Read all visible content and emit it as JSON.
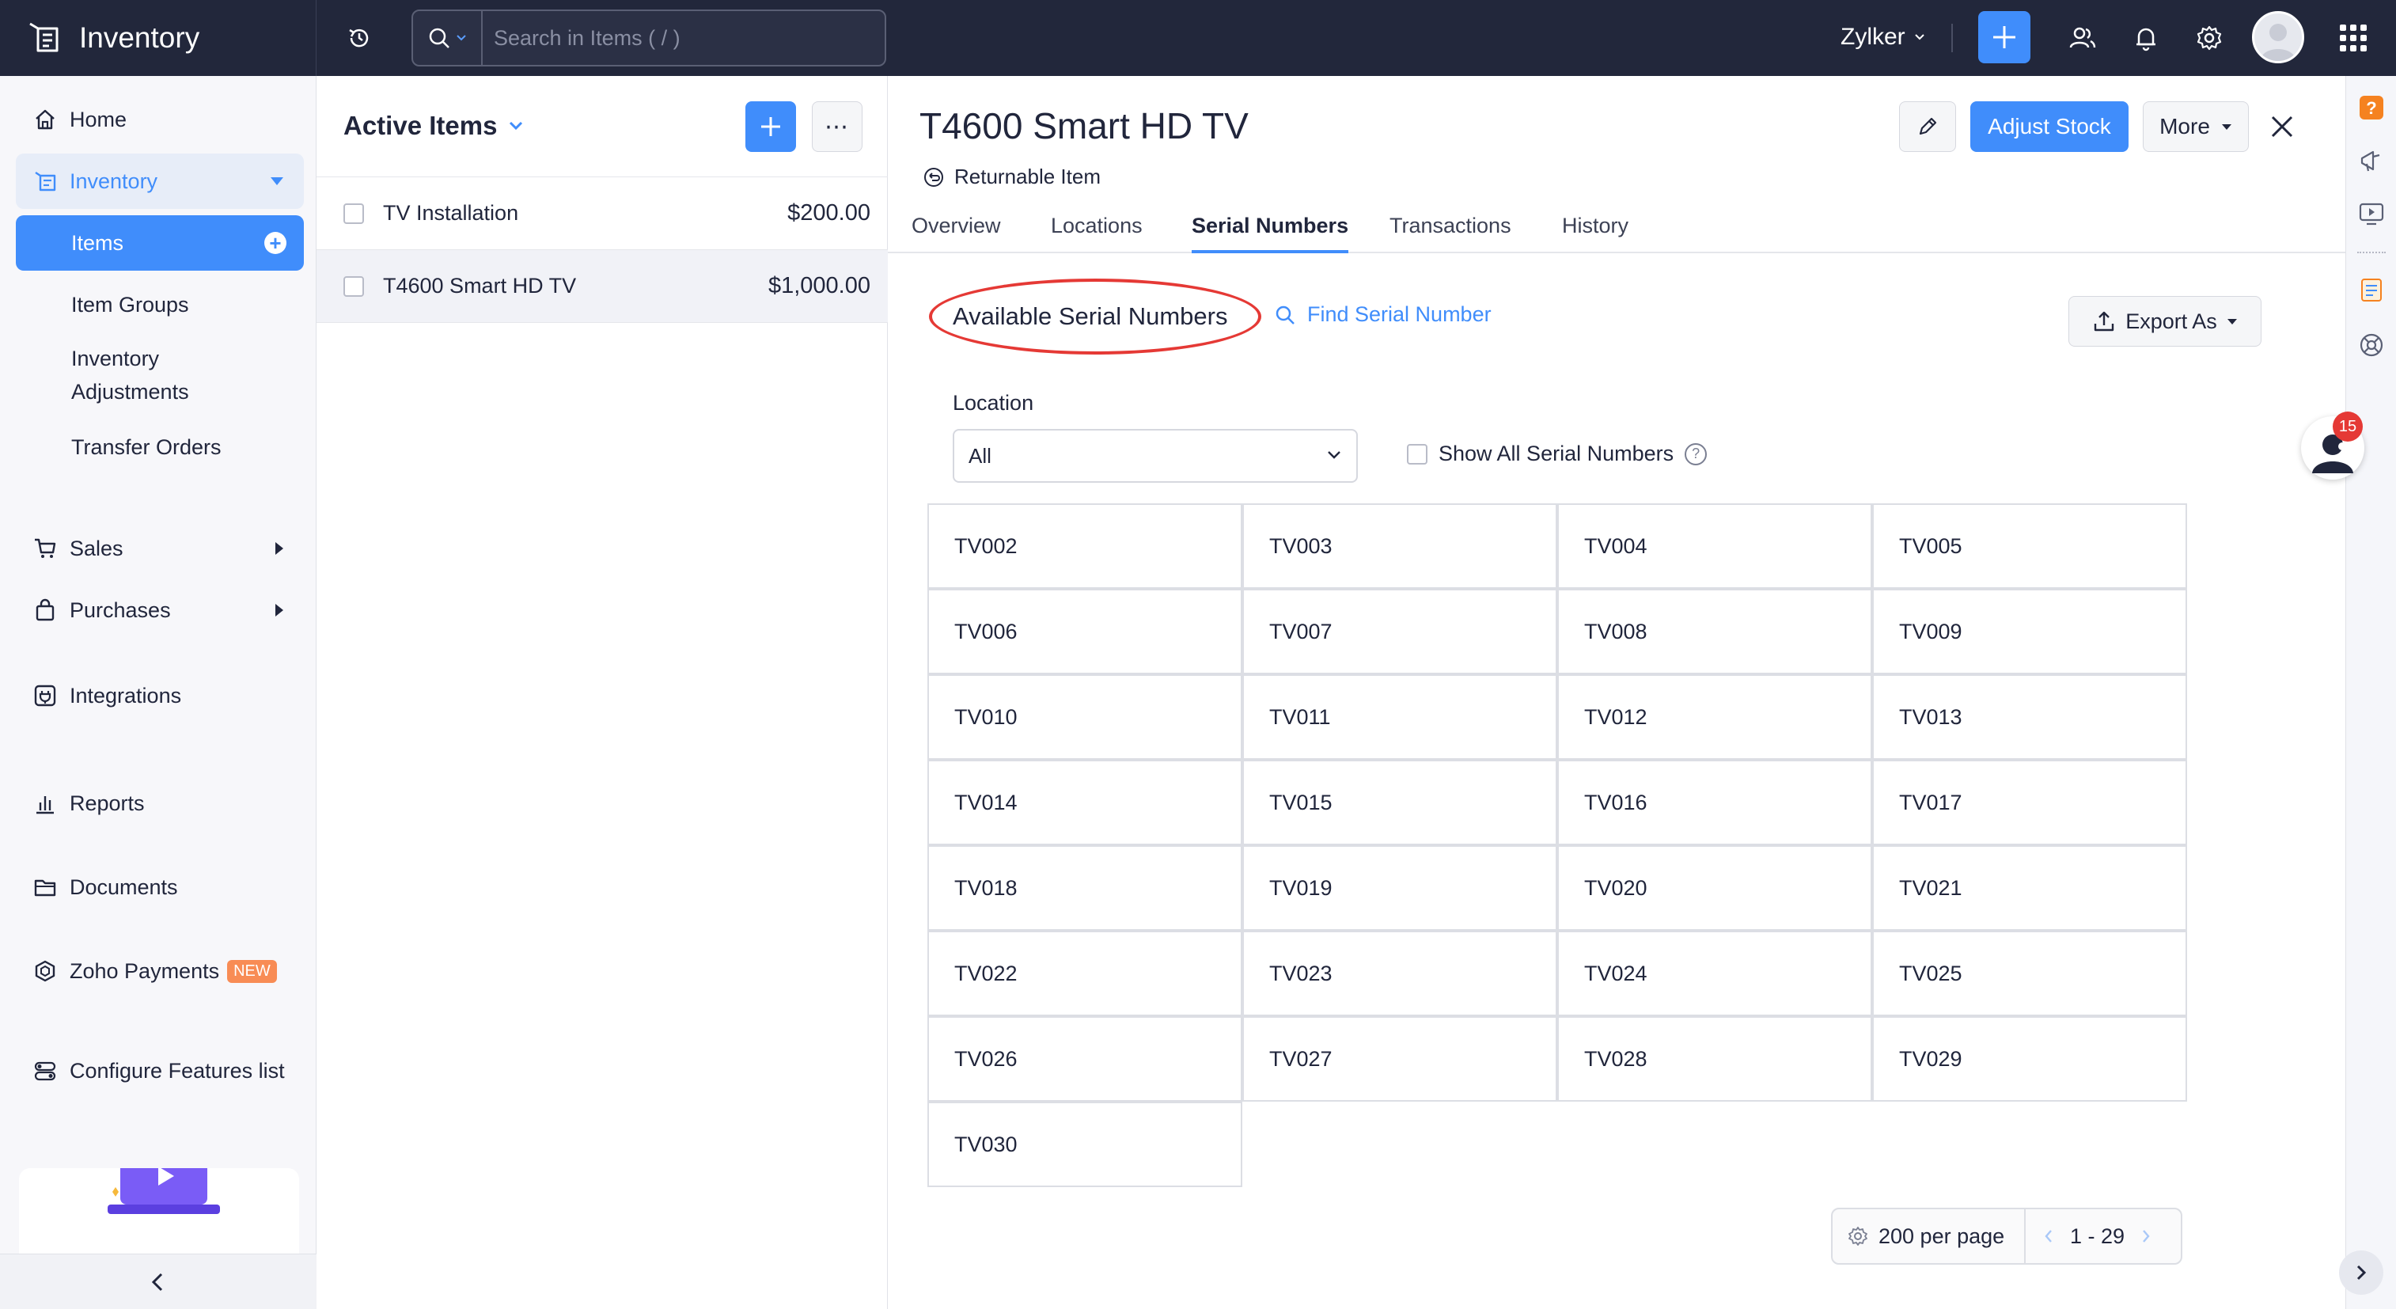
{
  "app": {
    "name": "Inventory",
    "org": "Zylker",
    "search_placeholder": "Search in Items ( / )"
  },
  "colors": {
    "primary": "#408dfb",
    "topbar": "#22273b",
    "annotation": "#e53935",
    "badge_new": "#f88c55"
  },
  "sidebar": {
    "home": "Home",
    "inventory": "Inventory",
    "items": "Items",
    "item_groups": "Item Groups",
    "inventory_adjustments_line1": "Inventory",
    "inventory_adjustments_line2": "Adjustments",
    "transfer_orders": "Transfer Orders",
    "sales": "Sales",
    "purchases": "Purchases",
    "integrations": "Integrations",
    "reports": "Reports",
    "documents": "Documents",
    "zoho_payments": "Zoho Payments",
    "new_badge": "NEW",
    "configure": "Configure Features list"
  },
  "list": {
    "title": "Active Items",
    "items": [
      {
        "name": "TV Installation",
        "price": "$200.00"
      },
      {
        "name": "T4600 Smart HD TV",
        "price": "$1,000.00"
      }
    ]
  },
  "detail": {
    "title": "T4600 Smart HD TV",
    "returnable": "Returnable Item",
    "adjust_stock": "Adjust Stock",
    "more": "More",
    "tabs": [
      "Overview",
      "Locations",
      "Serial Numbers",
      "Transactions",
      "History"
    ],
    "active_tab": "Serial Numbers",
    "section_title": "Available Serial Numbers",
    "find_serial": "Find Serial Number",
    "export": "Export As",
    "location_label": "Location",
    "location_value": "All",
    "show_all": "Show All Serial Numbers",
    "serials": [
      "TV002",
      "TV003",
      "TV004",
      "TV005",
      "TV006",
      "TV007",
      "TV008",
      "TV009",
      "TV010",
      "TV011",
      "TV012",
      "TV013",
      "TV014",
      "TV015",
      "TV016",
      "TV017",
      "TV018",
      "TV019",
      "TV020",
      "TV021",
      "TV022",
      "TV023",
      "TV024",
      "TV025",
      "TV026",
      "TV027",
      "TV028",
      "TV029",
      "TV030"
    ],
    "per_page": "200 per page",
    "range": "1 - 29"
  },
  "rail": {
    "notification_count": "15"
  }
}
